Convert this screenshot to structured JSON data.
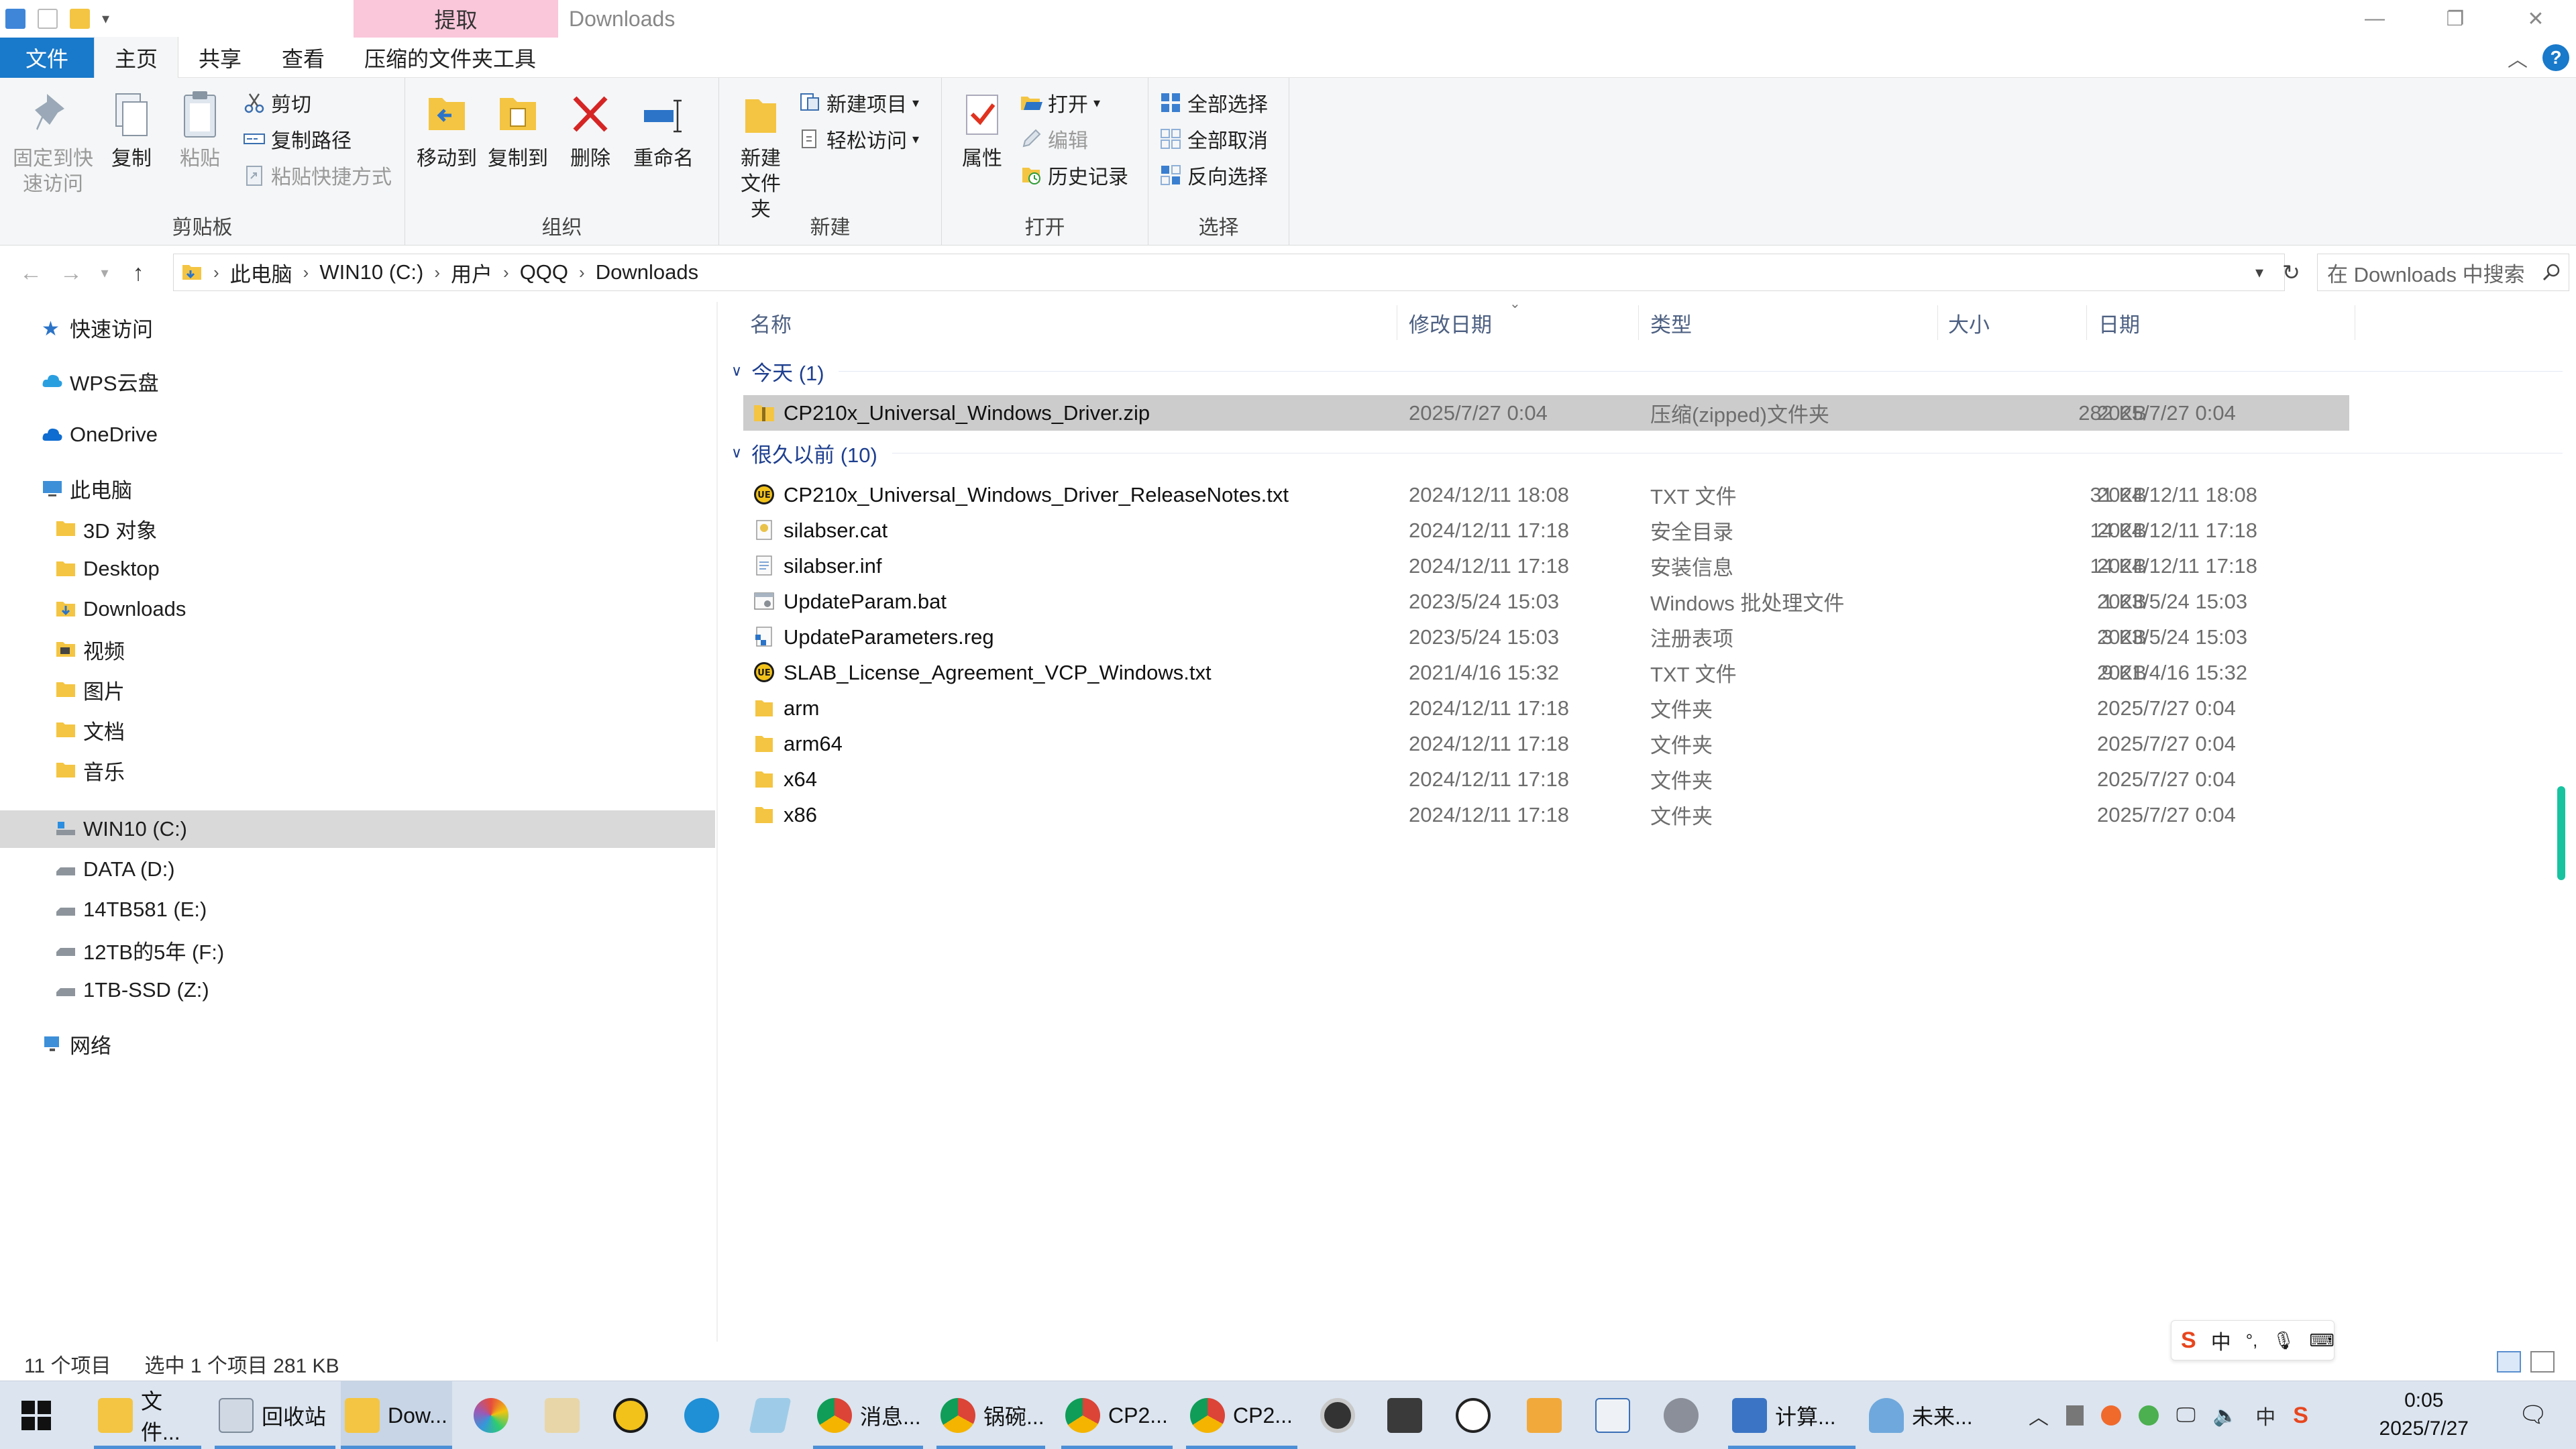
{
  "window": {
    "title": "Downloads",
    "context_tab_header": "提取"
  },
  "tabs": {
    "file": "文件",
    "home": "主页",
    "share": "共享",
    "view": "查看",
    "compressed_tools": "压缩的文件夹工具"
  },
  "ribbon": {
    "clipboard": {
      "label": "剪贴板",
      "pin": "固定到快速访问",
      "copy": "复制",
      "paste": "粘贴",
      "cut": "剪切",
      "copy_path": "复制路径",
      "paste_shortcut": "粘贴快捷方式"
    },
    "organize": {
      "label": "组织",
      "move_to": "移动到",
      "copy_to": "复制到",
      "delete": "删除",
      "rename": "重命名"
    },
    "new": {
      "label": "新建",
      "new_folder": "新建文件夹",
      "new_item": "新建项目",
      "easy_access": "轻松访问"
    },
    "open": {
      "label": "打开",
      "properties": "属性",
      "open": "打开",
      "edit": "编辑",
      "history": "历史记录"
    },
    "select": {
      "label": "选择",
      "select_all": "全部选择",
      "select_none": "全部取消",
      "invert": "反向选择"
    }
  },
  "address": {
    "crumbs": [
      "此电脑",
      "WIN10 (C:)",
      "用户",
      "QQQ",
      "Downloads"
    ],
    "search_placeholder": "在 Downloads 中搜索"
  },
  "nav": {
    "quick_access": "快速访问",
    "wps": "WPS云盘",
    "onedrive": "OneDrive",
    "this_pc": "此电脑",
    "objects3d": "3D 对象",
    "desktop": "Desktop",
    "downloads": "Downloads",
    "videos": "视频",
    "pictures": "图片",
    "documents": "文档",
    "music": "音乐",
    "drive_c": "WIN10 (C:)",
    "drive_d": "DATA (D:)",
    "drive_e": "14TB581 (E:)",
    "drive_f": "12TB的5年 (F:)",
    "drive_z": "1TB-SSD (Z:)",
    "network": "网络"
  },
  "columns": {
    "name": "名称",
    "modified": "修改日期",
    "type": "类型",
    "size": "大小",
    "date": "日期"
  },
  "groups": {
    "today": "今天 (1)",
    "long_ago": "很久以前 (10)"
  },
  "files_today": [
    {
      "name": "CP210x_Universal_Windows_Driver.zip",
      "modified": "2025/7/27 0:04",
      "type": "压缩(zipped)文件夹",
      "size": "282 KB",
      "date": "2025/7/27 0:04"
    }
  ],
  "files_old": [
    {
      "name": "CP210x_Universal_Windows_Driver_ReleaseNotes.txt",
      "modified": "2024/12/11 18:08",
      "type": "TXT 文件",
      "size": "31 KB",
      "date": "2024/12/11 18:08"
    },
    {
      "name": "silabser.cat",
      "modified": "2024/12/11 17:18",
      "type": "安全目录",
      "size": "14 KB",
      "date": "2024/12/11 17:18"
    },
    {
      "name": "silabser.inf",
      "modified": "2024/12/11 17:18",
      "type": "安装信息",
      "size": "14 KB",
      "date": "2024/12/11 17:18"
    },
    {
      "name": "UpdateParam.bat",
      "modified": "2023/5/24 15:03",
      "type": "Windows 批处理文件",
      "size": "1 KB",
      "date": "2023/5/24 15:03"
    },
    {
      "name": "UpdateParameters.reg",
      "modified": "2023/5/24 15:03",
      "type": "注册表项",
      "size": "3 KB",
      "date": "2023/5/24 15:03"
    },
    {
      "name": "SLAB_License_Agreement_VCP_Windows.txt",
      "modified": "2021/4/16 15:32",
      "type": "TXT 文件",
      "size": "9 KB",
      "date": "2021/4/16 15:32"
    },
    {
      "name": "arm",
      "modified": "2024/12/11 17:18",
      "type": "文件夹",
      "size": "",
      "date": "2025/7/27 0:04"
    },
    {
      "name": "arm64",
      "modified": "2024/12/11 17:18",
      "type": "文件夹",
      "size": "",
      "date": "2025/7/27 0:04"
    },
    {
      "name": "x64",
      "modified": "2024/12/11 17:18",
      "type": "文件夹",
      "size": "",
      "date": "2025/7/27 0:04"
    },
    {
      "name": "x86",
      "modified": "2024/12/11 17:18",
      "type": "文件夹",
      "size": "",
      "date": "2025/7/27 0:04"
    }
  ],
  "status": {
    "count": "11 个项目",
    "selected": "选中 1 个项目  281 KB"
  },
  "taskbar": {
    "files": "文件...",
    "recycle": "回收站",
    "downloads": "Dow...",
    "chrome1": "消息...",
    "chrome2": "锅碗...",
    "chrome3": "CP2...",
    "chrome4": "CP2...",
    "calc": "计算...",
    "weather": "未来...",
    "time": "0:05",
    "date": "2025/7/27",
    "ime_lang": "中"
  },
  "colors": {
    "accent": "#1979ca",
    "context_tab": "#f9c6da",
    "selection": "#cccccc",
    "group_header": "#1e3f8f",
    "folder": "#f4c542"
  }
}
